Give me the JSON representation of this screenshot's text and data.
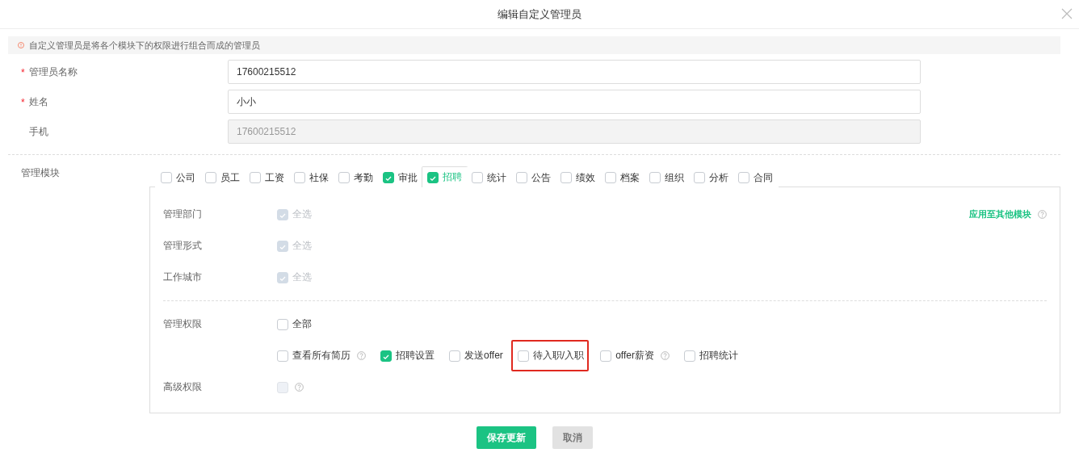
{
  "dialog": {
    "title": "编辑自定义管理员"
  },
  "notice": "自定义管理员是将各个模块下的权限进行组合而成的管理员",
  "fields": [
    {
      "label": "管理员名称",
      "required_mark": "*",
      "value": "17600215512",
      "disabled": false
    },
    {
      "label": "姓名",
      "required_mark": "*",
      "value": "小小",
      "disabled": false
    },
    {
      "label": "手机",
      "value": "17600215512",
      "disabled": true
    }
  ],
  "modules_label": "管理模块",
  "modules": [
    {
      "label": "公司",
      "checked": false,
      "selected": false
    },
    {
      "label": "员工",
      "checked": false,
      "selected": false
    },
    {
      "label": "工资",
      "checked": false,
      "selected": false
    },
    {
      "label": "社保",
      "checked": false,
      "selected": false
    },
    {
      "label": "考勤",
      "checked": false,
      "selected": false
    },
    {
      "label": "审批",
      "checked": true,
      "selected": false
    },
    {
      "label": "招聘",
      "checked": true,
      "selected": true
    },
    {
      "label": "统计",
      "checked": false,
      "selected": false
    },
    {
      "label": "公告",
      "checked": false,
      "selected": false
    },
    {
      "label": "绩效",
      "checked": false,
      "selected": false
    },
    {
      "label": "档案",
      "checked": false,
      "selected": false
    },
    {
      "label": "组织",
      "checked": false,
      "selected": false
    },
    {
      "label": "分析",
      "checked": false,
      "selected": false
    },
    {
      "label": "合同",
      "checked": false,
      "selected": false
    }
  ],
  "apply_link": "应用至其他模块",
  "scopes": [
    {
      "label": "管理部门",
      "option": "全选",
      "checked": true,
      "disabled": true
    },
    {
      "label": "管理形式",
      "option": "全选",
      "checked": true,
      "disabled": true
    },
    {
      "label": "工作城市",
      "option": "全选",
      "checked": true,
      "disabled": true
    }
  ],
  "permissions": {
    "label": "管理权限",
    "all": {
      "label": "全部",
      "checked": false
    },
    "items": [
      {
        "label": "查看所有简历",
        "checked": false,
        "help": true,
        "highlighted": false
      },
      {
        "label": "招聘设置",
        "checked": true,
        "help": false,
        "highlighted": false
      },
      {
        "label": "发送offer",
        "checked": false,
        "help": false,
        "highlighted": false
      },
      {
        "label": "待入职/入职",
        "checked": false,
        "help": false,
        "highlighted": true
      },
      {
        "label": "offer薪资",
        "checked": false,
        "help": true,
        "highlighted": false
      },
      {
        "label": "招聘统计",
        "checked": false,
        "help": false,
        "highlighted": false
      }
    ]
  },
  "advanced": {
    "label": "高级权限",
    "checked": false,
    "disabled": true,
    "help": true
  },
  "buttons": [
    {
      "label": "保存更新",
      "kind": "primary"
    },
    {
      "label": "取消",
      "kind": "disabled"
    }
  ]
}
